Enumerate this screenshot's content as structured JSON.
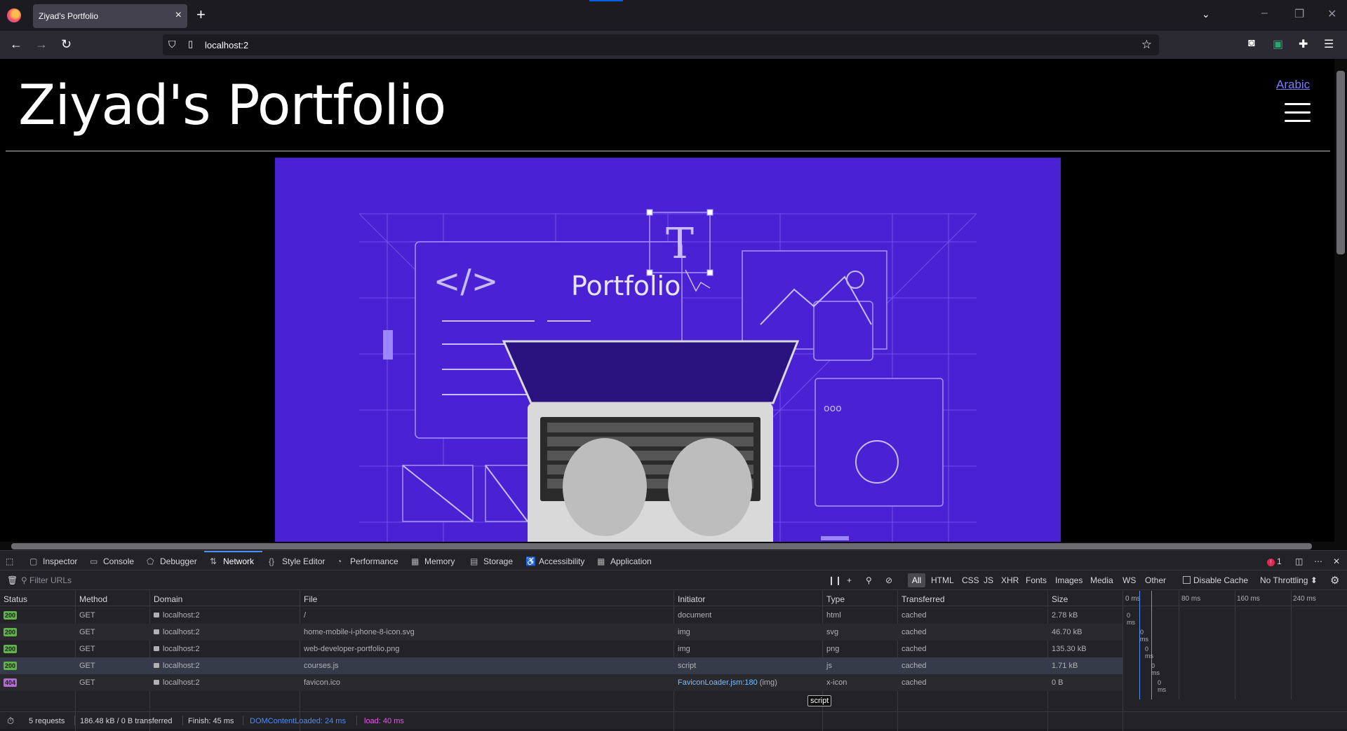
{
  "browser": {
    "tab_title": "Ziyad's Portfolio",
    "url": "localhost:2"
  },
  "page": {
    "title": "Ziyad's Portfolio",
    "language_link": "Arabic",
    "hero": {
      "word": "Portfolio",
      "letter": "T",
      "code_glyph": "</>",
      "dots": "ooo"
    }
  },
  "devtools": {
    "tabs": [
      {
        "label": "Inspector",
        "icon": "inspector-icon"
      },
      {
        "label": "Console",
        "icon": "console-icon"
      },
      {
        "label": "Debugger",
        "icon": "debugger-icon"
      },
      {
        "label": "Network",
        "icon": "network-icon"
      },
      {
        "label": "Style Editor",
        "icon": "style-editor-icon"
      },
      {
        "label": "Performance",
        "icon": "performance-icon"
      },
      {
        "label": "Memory",
        "icon": "memory-icon"
      },
      {
        "label": "Storage",
        "icon": "storage-icon"
      },
      {
        "label": "Accessibility",
        "icon": "accessibility-icon"
      },
      {
        "label": "Application",
        "icon": "application-icon"
      }
    ],
    "active_tab": "Network",
    "error_count": "1",
    "filter_placeholder": "Filter URLs",
    "filters": [
      "All",
      "HTML",
      "CSS",
      "JS",
      "XHR",
      "Fonts",
      "Images",
      "Media",
      "WS",
      "Other"
    ],
    "active_filter": "All",
    "disable_cache": "Disable Cache",
    "throttling": "No Throttling ⬍",
    "columns": [
      "Status",
      "Method",
      "Domain",
      "File",
      "Initiator",
      "Type",
      "Transferred",
      "Size"
    ],
    "timeline_ticks": [
      "0 ms",
      "80 ms",
      "160 ms",
      "240 ms"
    ],
    "requests": [
      {
        "status": "200",
        "method": "GET",
        "domain": "localhost:2",
        "file": "/",
        "initiator": "document",
        "type": "html",
        "transferred": "cached",
        "size": "2.78 kB",
        "timing": "0 ms"
      },
      {
        "status": "200",
        "method": "GET",
        "domain": "localhost:2",
        "file": "home-mobile-i-phone-8-icon.svg",
        "initiator": "img",
        "type": "svg",
        "transferred": "cached",
        "size": "46.70 kB",
        "timing": "0 ms"
      },
      {
        "status": "200",
        "method": "GET",
        "domain": "localhost:2",
        "file": "web-developer-portfolio.png",
        "initiator": "img",
        "type": "png",
        "transferred": "cached",
        "size": "135.30 kB",
        "timing": "0 ms"
      },
      {
        "status": "200",
        "method": "GET",
        "domain": "localhost:2",
        "file": "courses.js",
        "initiator": "script",
        "type": "js",
        "transferred": "cached",
        "size": "1.71 kB",
        "timing": "0 ms"
      },
      {
        "status": "404",
        "method": "GET",
        "domain": "localhost:2",
        "file": "favicon.ico",
        "initiator": "FaviconLoader.jsm:180",
        "initiator_suffix": " (img)",
        "type": "x-icon",
        "transferred": "cached",
        "size": "0 B",
        "timing": "0 ms"
      }
    ],
    "tooltip": "script",
    "summary": {
      "requests": "5 requests",
      "transferred": "186.48 kB / 0 B transferred",
      "finish": "Finish: 45 ms",
      "dom_content_loaded": "DOMContentLoaded: 24 ms",
      "load": "load: 40 ms"
    }
  },
  "colors": {
    "hero_bg": "#4b21d4",
    "link": "#7f7cff",
    "status_ok": "#5fb548",
    "status_not_found": "#b36bd6",
    "dom_loaded": "#4b8dfc",
    "load": "#e45ae6"
  }
}
